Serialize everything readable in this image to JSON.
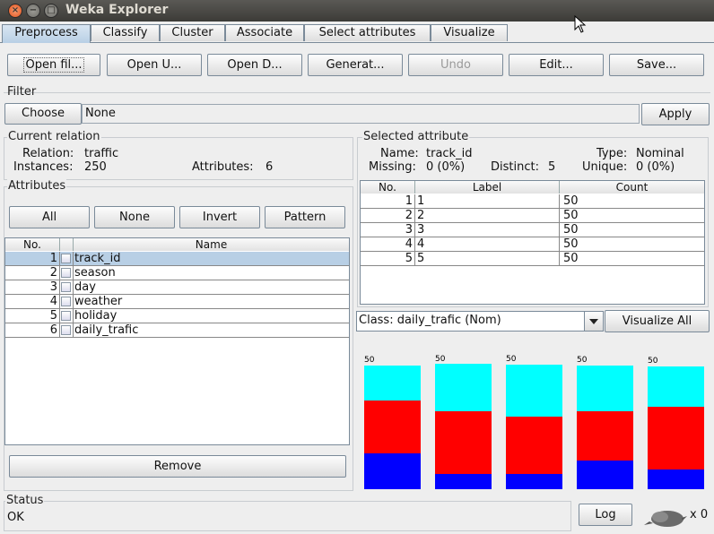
{
  "window": {
    "title": "Weka Explorer"
  },
  "tabs": [
    {
      "label": "Preprocess",
      "active": true
    },
    {
      "label": "Classify"
    },
    {
      "label": "Cluster"
    },
    {
      "label": "Associate"
    },
    {
      "label": "Select attributes"
    },
    {
      "label": "Visualize"
    }
  ],
  "toolbar": {
    "open_file": "Open fil...",
    "open_url": "Open U...",
    "open_db": "Open D...",
    "generate": "Generat...",
    "undo": "Undo",
    "edit": "Edit...",
    "save": "Save..."
  },
  "filter": {
    "title": "Filter",
    "choose": "Choose",
    "value": "None",
    "apply": "Apply"
  },
  "current_relation": {
    "title": "Current relation",
    "relation_label": "Relation:",
    "relation": "traffic",
    "instances_label": "Instances:",
    "instances": "250",
    "attributes_label": "Attributes:",
    "attributes": "6"
  },
  "attributes_panel": {
    "title": "Attributes",
    "all": "All",
    "none": "None",
    "invert": "Invert",
    "pattern": "Pattern",
    "col_no": "No.",
    "col_name": "Name",
    "rows": [
      {
        "no": "1",
        "name": "track_id"
      },
      {
        "no": "2",
        "name": "season"
      },
      {
        "no": "3",
        "name": "day"
      },
      {
        "no": "4",
        "name": "weather"
      },
      {
        "no": "5",
        "name": "holiday"
      },
      {
        "no": "6",
        "name": "daily_trafic"
      }
    ],
    "remove": "Remove"
  },
  "selected_attribute": {
    "title": "Selected attribute",
    "name_label": "Name:",
    "name": "track_id",
    "type_label": "Type:",
    "type": "Nominal",
    "missing_label": "Missing:",
    "missing": "0 (0%)",
    "distinct_label": "Distinct:",
    "distinct": "5",
    "unique_label": "Unique:",
    "unique": "0 (0%)",
    "col_no": "No.",
    "col_label": "Label",
    "col_count": "Count",
    "rows": [
      {
        "no": "1",
        "label": "1",
        "count": "50"
      },
      {
        "no": "2",
        "label": "2",
        "count": "50"
      },
      {
        "no": "3",
        "label": "3",
        "count": "50"
      },
      {
        "no": "4",
        "label": "4",
        "count": "50"
      },
      {
        "no": "5",
        "label": "5",
        "count": "50"
      }
    ]
  },
  "class_select": {
    "value": "Class: daily_trafic (Nom)",
    "visualize_all": "Visualize All"
  },
  "histogram": {
    "colors": {
      "a": "#0000ff",
      "b": "#ff0000",
      "c": "#00ffff"
    },
    "bars": [
      {
        "label": "50",
        "fractions": [
          0.29,
          0.43,
          0.28
        ]
      },
      {
        "label": "50",
        "fractions": [
          0.12,
          0.5,
          0.38
        ]
      },
      {
        "label": "50",
        "fractions": [
          0.12,
          0.46,
          0.42
        ]
      },
      {
        "label": "50",
        "fractions": [
          0.23,
          0.4,
          0.37
        ]
      },
      {
        "label": "50",
        "fractions": [
          0.16,
          0.51,
          0.33
        ]
      }
    ]
  },
  "status": {
    "title": "Status",
    "text": "OK",
    "log": "Log",
    "count": "x 0"
  }
}
